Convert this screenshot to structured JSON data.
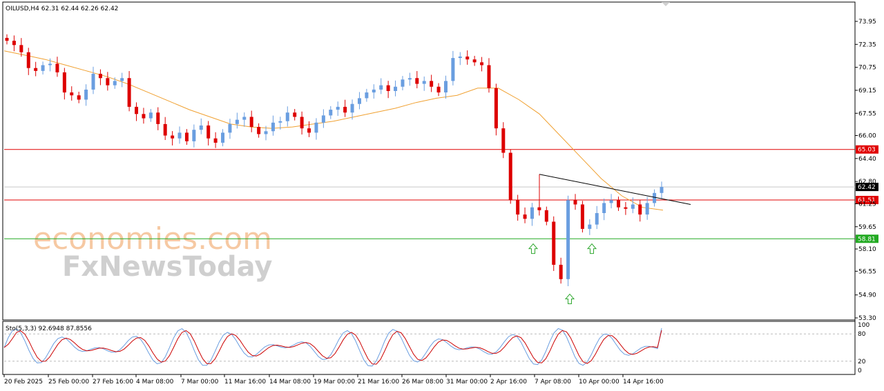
{
  "header": {
    "symbol_line": "OILUSD,H4  62.31 62.44 62.26 62.42"
  },
  "watermark": {
    "line1": "economies.com",
    "line2": "FxNewsToday"
  },
  "price_axis": {
    "ticks": [
      "73.95",
      "72.35",
      "70.75",
      "69.15",
      "67.55",
      "66.00",
      "64.40",
      "62.80",
      "61.25",
      "59.65",
      "58.10",
      "56.55",
      "54.90",
      "53.30"
    ],
    "tick_values": [
      73.95,
      72.35,
      70.75,
      69.15,
      67.55,
      66.0,
      64.4,
      62.8,
      61.25,
      59.65,
      58.1,
      56.55,
      54.9,
      53.3
    ]
  },
  "levels": [
    {
      "label": "65.03",
      "value": 65.03,
      "color": "#e00000"
    },
    {
      "label": "62.42",
      "value": 62.42,
      "color": "#000000"
    },
    {
      "label": "61.51",
      "value": 61.51,
      "color": "#e00000"
    },
    {
      "label": "58.81",
      "value": 58.81,
      "color": "#22aa22"
    }
  ],
  "colors": {
    "bull": "#6a9ee0",
    "bear": "#dd0000",
    "ma": "#f0a030",
    "stoch_main": "#6a9ee0",
    "stoch_signal": "#cc0000",
    "support_line": "#33aa33",
    "resistance_line": "#dd2222",
    "current_line": "#c8c8c8"
  },
  "indicator": {
    "label": "Sto(5,3,3) 92.6948 87.8556",
    "ticks": [
      "100",
      "80",
      "20",
      "0"
    ],
    "tick_values": [
      100,
      80,
      20,
      0
    ]
  },
  "time_axis": {
    "labels": [
      "20 Feb 2025",
      "25 Feb 00:00",
      "27 Feb 16:00",
      "4 Mar 08:00",
      "7 Mar 00:00",
      "11 Mar 16:00",
      "14 Mar 08:00",
      "19 Mar 00:00",
      "21 Mar 16:00",
      "26 Mar 08:00",
      "31 Mar 00:00",
      "2 Apr 16:00",
      "7 Apr 08:00",
      "10 Apr 00:00",
      "14 Apr 16:00"
    ]
  },
  "chart_data": {
    "type": "candlestick",
    "symbol": "OILUSD",
    "timeframe": "H4",
    "last": {
      "open": 62.31,
      "high": 62.44,
      "low": 62.26,
      "close": 62.42
    },
    "closes": [
      72.6,
      72.3,
      71.8,
      70.7,
      70.5,
      70.9,
      71.0,
      70.4,
      69.0,
      68.8,
      68.5,
      69.2,
      70.3,
      70.0,
      69.5,
      69.8,
      70.0,
      68.0,
      67.5,
      67.2,
      67.6,
      66.8,
      66.0,
      65.8,
      66.2,
      65.6,
      66.4,
      66.7,
      65.8,
      65.5,
      66.2,
      66.8,
      67.1,
      67.3,
      66.6,
      66.1,
      66.3,
      66.9,
      67.0,
      67.6,
      67.3,
      66.5,
      66.2,
      66.9,
      67.4,
      67.8,
      68.0,
      67.6,
      68.2,
      68.6,
      69.0,
      69.2,
      69.5,
      69.1,
      69.4,
      69.9,
      70.0,
      69.6,
      69.8,
      69.4,
      69.0,
      69.8,
      71.4,
      71.5,
      71.3,
      71.1,
      70.9,
      69.3,
      66.5,
      64.8,
      61.5,
      60.5,
      60.2,
      61.0,
      60.8,
      60.0,
      57.0,
      56.0,
      61.5,
      61.2,
      59.5,
      59.8,
      60.6,
      61.3,
      61.5,
      61.0,
      60.9,
      61.2,
      60.5,
      61.3,
      62.0,
      62.42
    ],
    "ma_values": [
      71.9,
      71.6,
      71.3,
      70.9,
      70.5,
      70.1,
      69.6,
      69.0,
      68.4,
      67.8,
      67.3,
      66.8,
      66.6,
      66.5,
      66.6,
      66.8,
      67.0,
      67.3,
      67.6,
      67.9,
      68.3,
      68.6,
      68.8,
      69.3,
      69.3,
      68.5,
      67.5,
      66.0,
      64.5,
      63.0,
      61.8,
      61.0,
      60.8
    ],
    "ma_period_note": "",
    "ylim": [
      53.3,
      74.6
    ],
    "trendline": {
      "from": {
        "x": "7 Apr 08:00",
        "y": 63.3
      },
      "to": {
        "x": "after 14 Apr 16:00",
        "y": 61.2
      }
    },
    "arrows": [
      {
        "x": "7 Apr 08:00",
        "y": 58.6,
        "dir": "up"
      },
      {
        "x": "10 Apr 00:00",
        "y": 55.1,
        "dir": "up"
      },
      {
        "x": "10 Apr 00:00",
        "y": 58.6,
        "dir": "up"
      }
    ],
    "stochastic": {
      "params": "5,3,3",
      "main": 92.6948,
      "signal": 87.8556,
      "levels": [
        80,
        20
      ],
      "ylim": [
        0,
        100
      ]
    }
  }
}
